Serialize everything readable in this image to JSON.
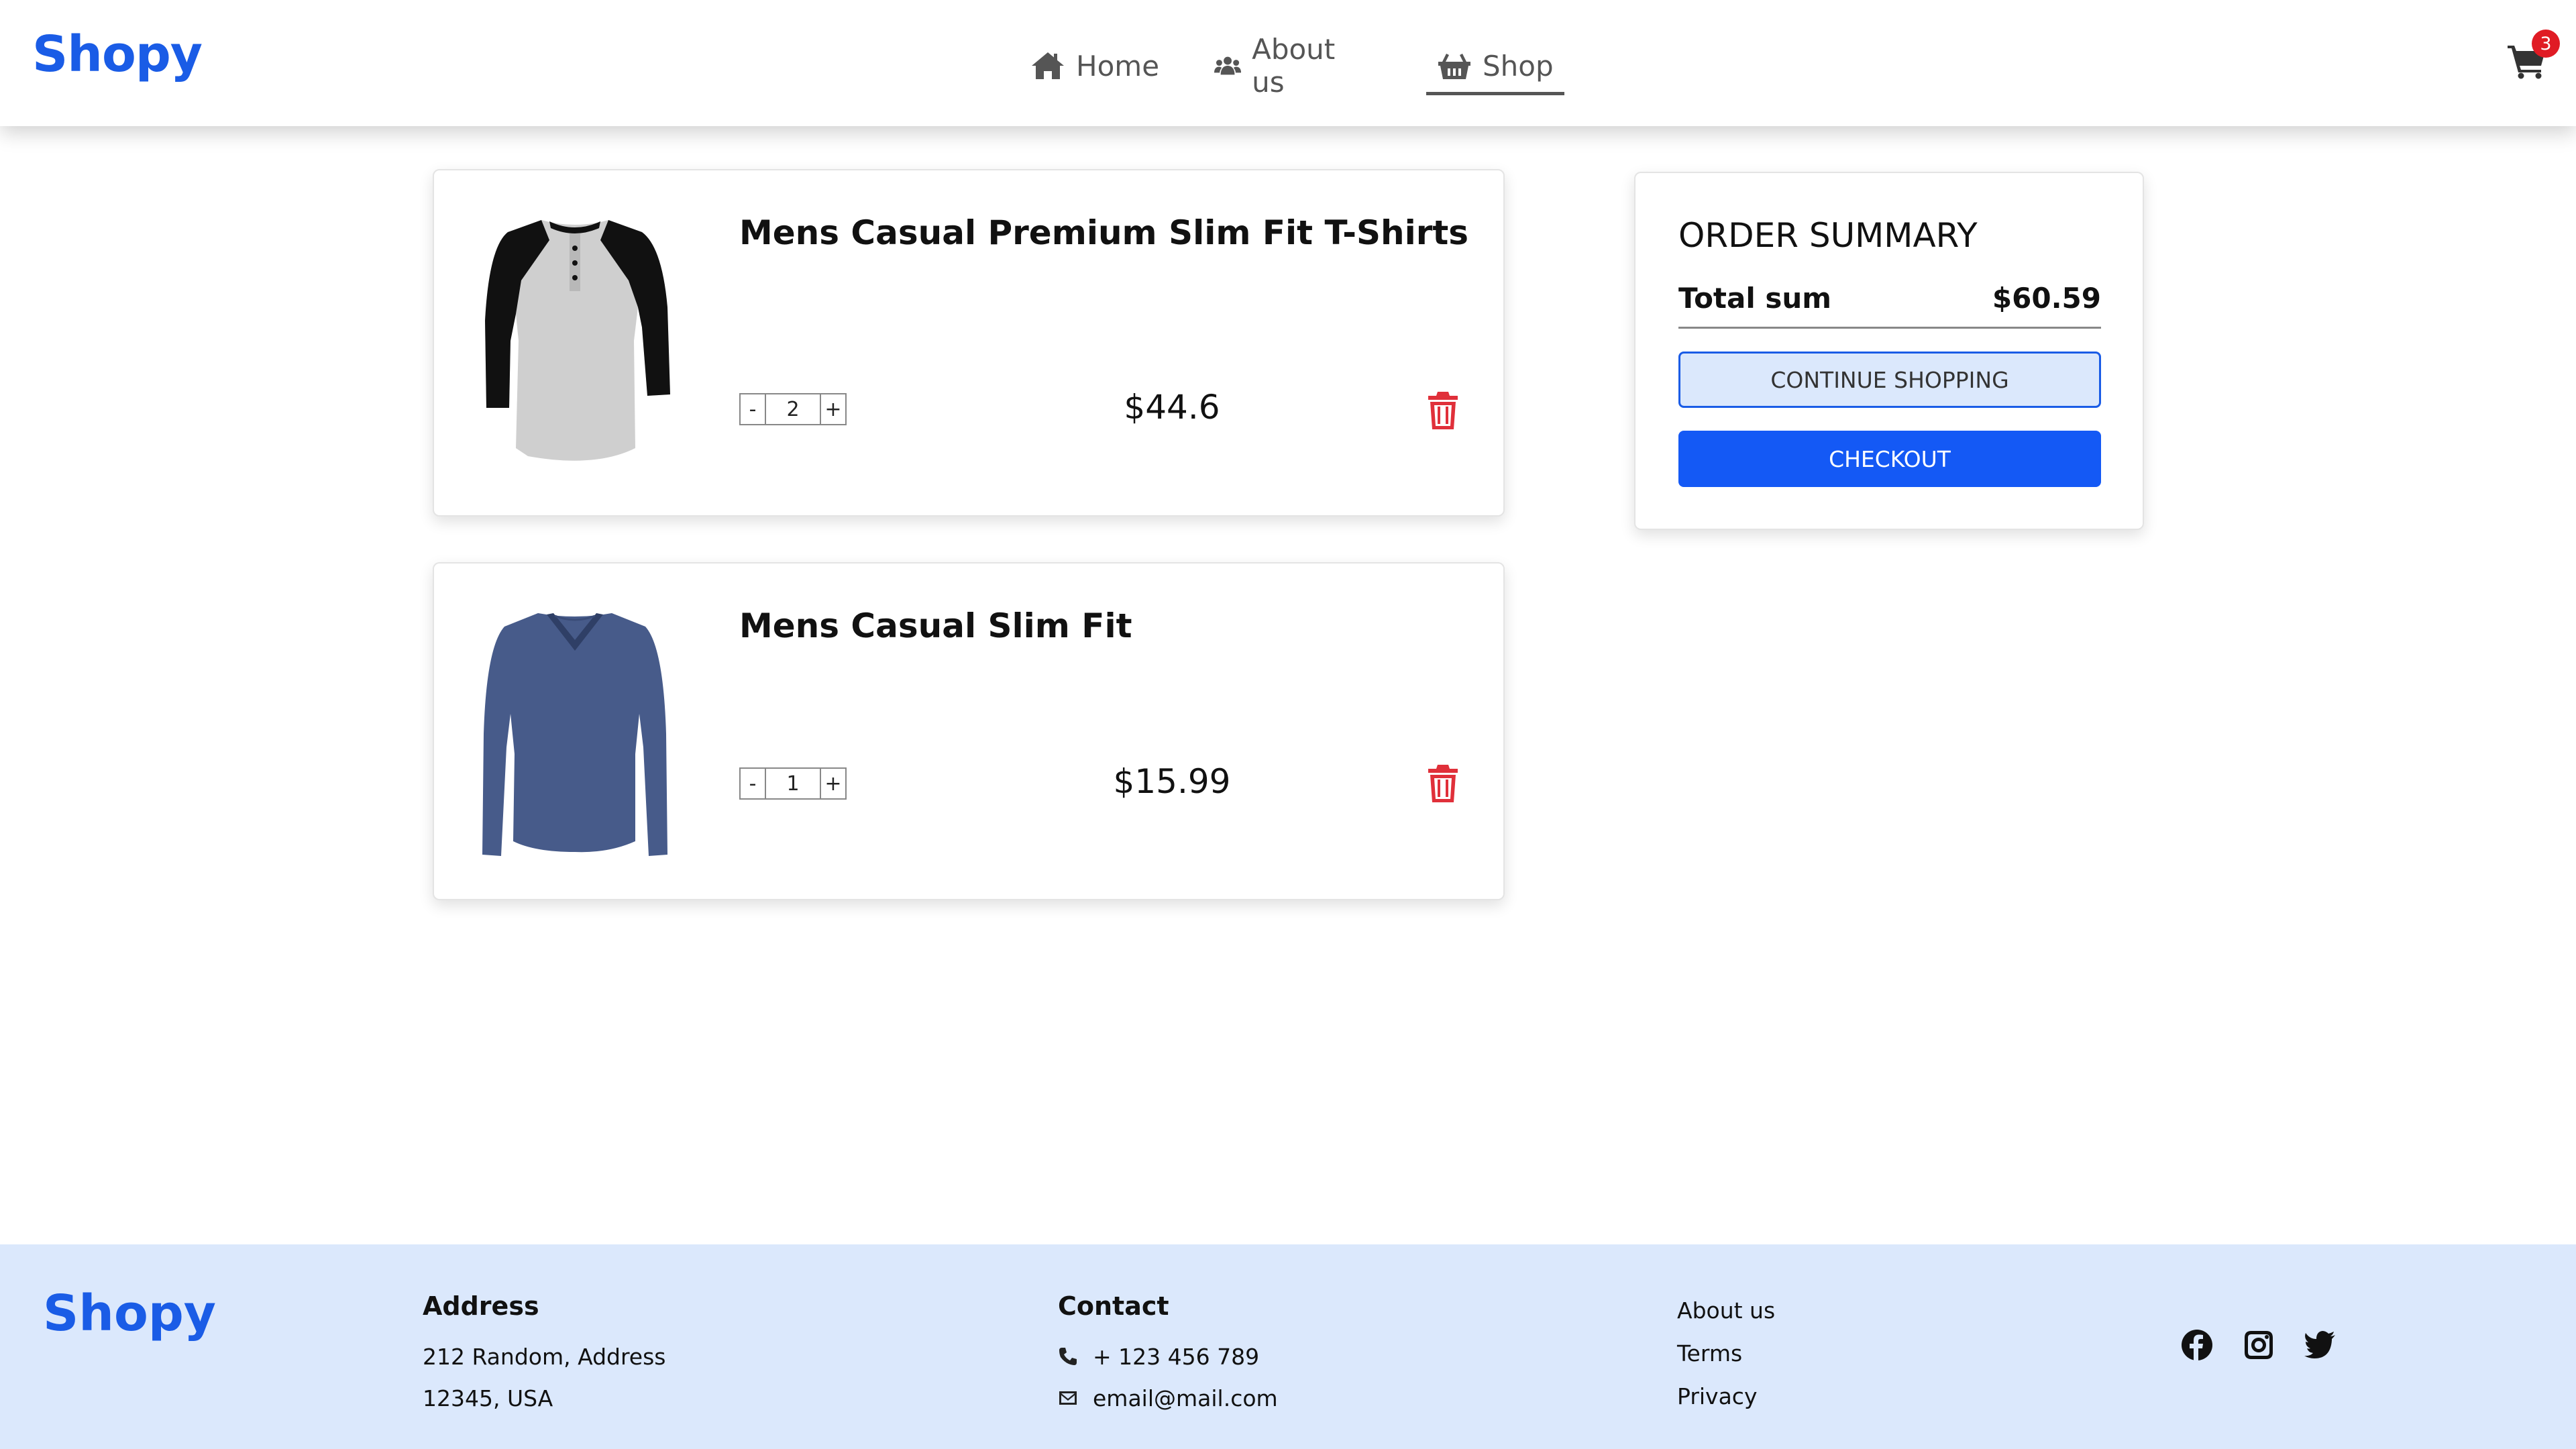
{
  "header": {
    "logo": "Shopy",
    "nav": [
      {
        "label": "Home",
        "icon": "home-icon"
      },
      {
        "label": "About us",
        "icon": "users-icon"
      },
      {
        "label": "Shop",
        "icon": "basket-icon",
        "active": true
      }
    ],
    "cart_count": "3"
  },
  "cart": {
    "items": [
      {
        "title": "Mens Casual Premium Slim Fit T-Shirts",
        "quantity": "2",
        "price": "$44.6",
        "minus": "-",
        "plus": "+"
      },
      {
        "title": "Mens Casual Slim Fit",
        "quantity": "1",
        "price": "$15.99",
        "minus": "-",
        "plus": "+"
      }
    ]
  },
  "summary": {
    "title": "ORDER SUMMARY",
    "total_label": "Total sum",
    "total_value": "$60.59",
    "continue_label": "CONTINUE SHOPPING",
    "checkout_label": "CHECKOUT"
  },
  "footer": {
    "logo": "Shopy",
    "address_heading": "Address",
    "address_line1": "212 Random, Address",
    "address_line2": "12345, USA",
    "contact_heading": "Contact",
    "phone": "+ 123 456 789",
    "email": "email@mail.com",
    "links": [
      "About us",
      "Terms",
      "Privacy"
    ],
    "social": [
      "facebook-icon",
      "instagram-icon",
      "twitter-icon"
    ]
  },
  "colors": {
    "brand": "#1a5ce6",
    "checkout": "#1459f5",
    "footer_bg": "#dbe8fc",
    "delete": "#e0303a",
    "badge": "#e01b24"
  }
}
